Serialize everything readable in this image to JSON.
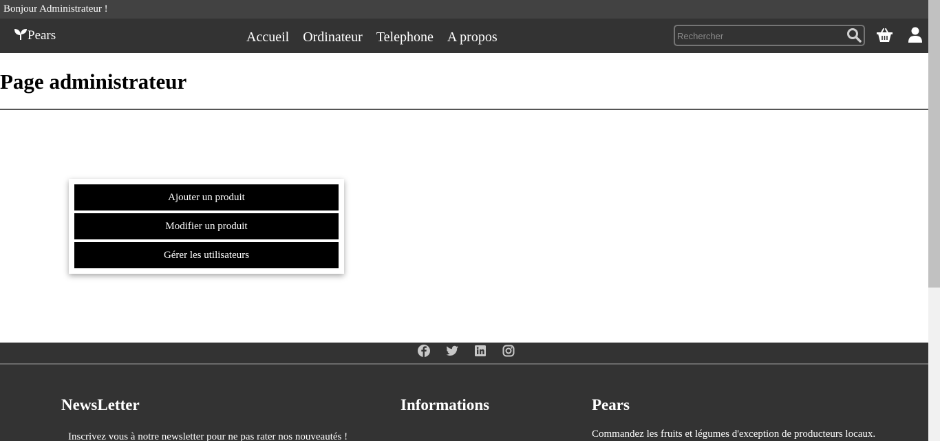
{
  "topbar": {
    "greeting": "Bonjour Administrateur !"
  },
  "navbar": {
    "brand": "Pears",
    "links": [
      "Accueil",
      "Ordinateur",
      "Telephone",
      "A propos"
    ],
    "search_placeholder": "Rechercher",
    "icons": [
      "search-icon",
      "basket-icon",
      "user-icon"
    ]
  },
  "main": {
    "title": "Page administrateur",
    "actions": [
      "Ajouter un produit",
      "Modifier un produit",
      "Gérer les utilisateurs"
    ]
  },
  "footer": {
    "social": [
      "facebook-icon",
      "twitter-icon",
      "linkedin-icon",
      "instagram-icon"
    ],
    "newsletter_title": "NewsLetter",
    "newsletter_text": "Inscrivez vous à notre newsletter pour ne pas rater nos nouveautés !",
    "info_title": "Informations",
    "brand_title": "Pears",
    "brand_text": "Commandez les fruits et légumes d'exception de producteurs locaux."
  },
  "colors": {
    "topbar": "#424242",
    "navbar": "#333333",
    "button": "#000000",
    "footer": "#333333"
  }
}
